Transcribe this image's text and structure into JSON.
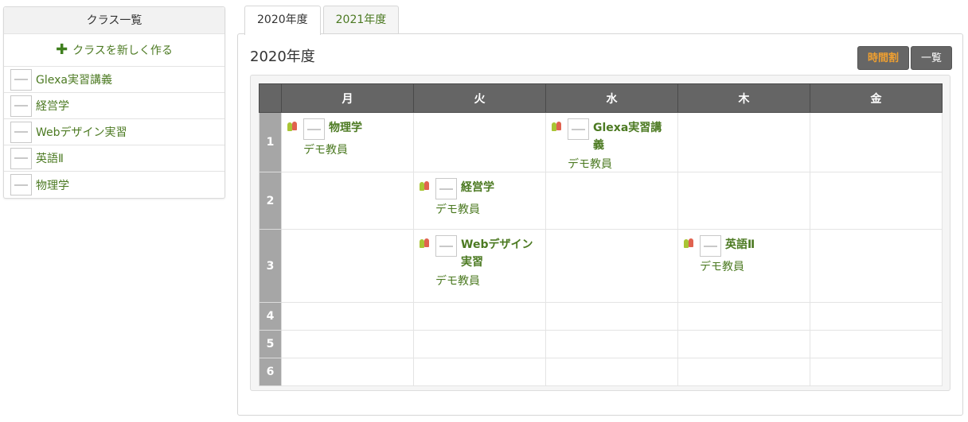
{
  "sidebar": {
    "title": "クラス一覧",
    "create_label": "クラスを新しく作る",
    "items": [
      {
        "label": "Glexa実習講義"
      },
      {
        "label": "経営学"
      },
      {
        "label": "Webデザイン実習"
      },
      {
        "label": "英語Ⅱ"
      },
      {
        "label": "物理学"
      }
    ]
  },
  "tabs": [
    {
      "label": "2020年度",
      "active": true
    },
    {
      "label": "2021年度",
      "active": false
    }
  ],
  "main": {
    "title": "2020年度",
    "buttons": {
      "timetable": "時間割",
      "list": "一覧"
    },
    "days": [
      "月",
      "火",
      "水",
      "木",
      "金"
    ],
    "periods": [
      "1",
      "2",
      "3",
      "4",
      "5",
      "6"
    ],
    "lessons": {
      "p1_mon": {
        "name": "物理学",
        "teacher": "デモ教員"
      },
      "p1_wed": {
        "name": "Glexa実習講義",
        "teacher": "デモ教員"
      },
      "p2_tue": {
        "name": "経営学",
        "teacher": "デモ教員"
      },
      "p3_tue": {
        "name": "Webデザイン実習",
        "teacher": "デモ教員"
      },
      "p3_thu": {
        "name": "英語Ⅱ",
        "teacher": "デモ教員"
      }
    }
  },
  "colors": {
    "link_green": "#4c7a22",
    "header_gray": "#656565",
    "period_gray": "#a6a6a6",
    "timetable_btn_text": "#f0a030"
  }
}
